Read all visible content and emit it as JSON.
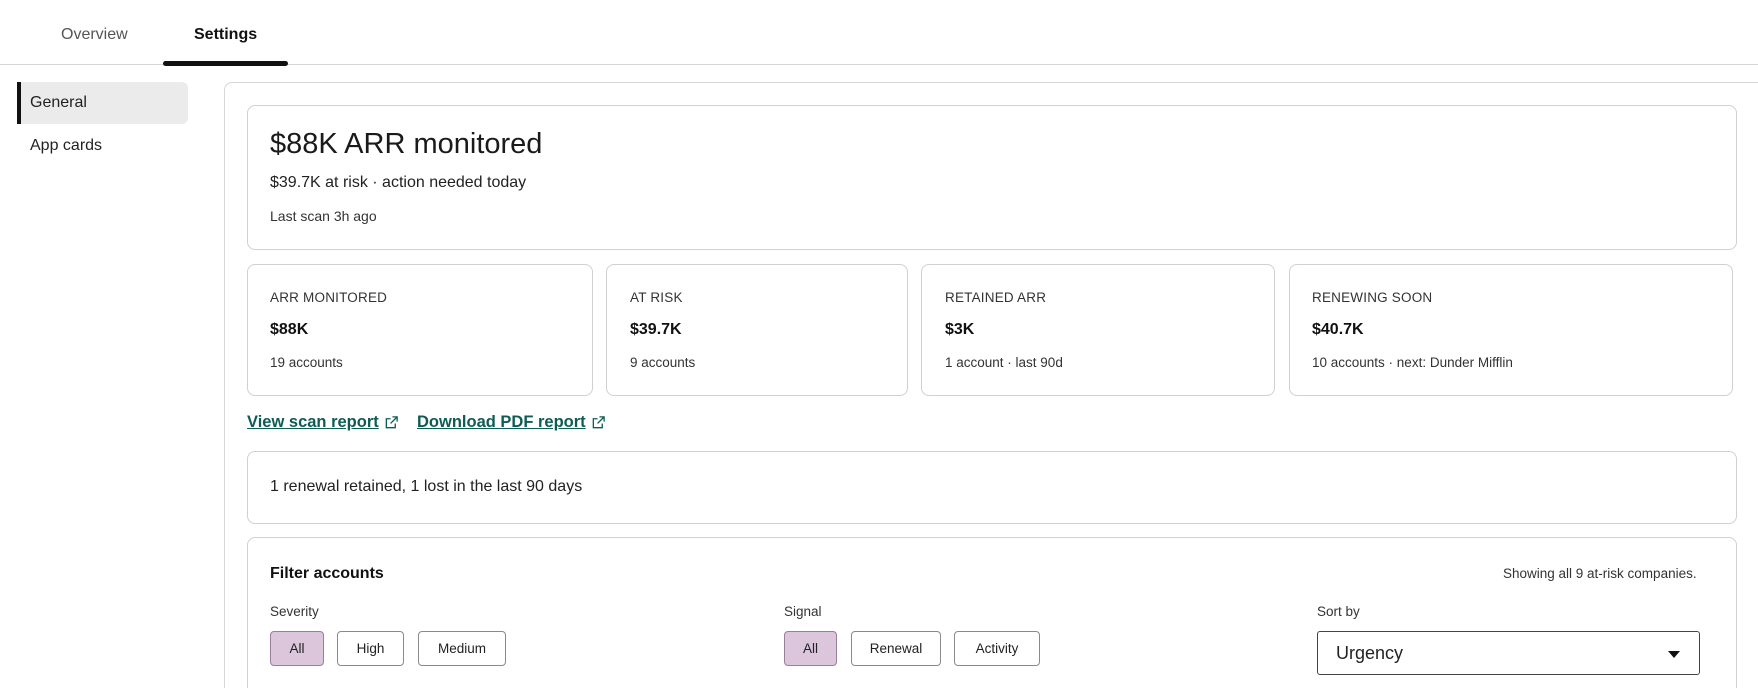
{
  "tabs": [
    {
      "label": "Overview",
      "active": false
    },
    {
      "label": "Settings",
      "active": true
    }
  ],
  "sidebar": {
    "items": [
      {
        "label": "General",
        "active": true
      },
      {
        "label": "App cards",
        "active": false
      }
    ]
  },
  "summary": {
    "title": "$88K ARR monitored",
    "subtitle": "$39.7K at risk · action needed today",
    "last_scan": "Last scan 3h ago"
  },
  "stats": [
    {
      "label": "ARR MONITORED",
      "value": "$88K",
      "sub": "19 accounts"
    },
    {
      "label": "AT RISK",
      "value": "$39.7K",
      "sub": "9 accounts"
    },
    {
      "label": "RETAINED ARR",
      "value": "$3K",
      "sub": "1 account · last 90d"
    },
    {
      "label": "RENEWING SOON",
      "value": "$40.7K",
      "sub": "10 accounts · next: Dunder Mifflin"
    }
  ],
  "links": {
    "view_scan": "View scan report",
    "download_pdf": "Download PDF report"
  },
  "retention_note": "1 renewal retained, 1 lost in the last 90 days",
  "filters": {
    "title": "Filter accounts",
    "count_text": "Showing all 9 at-risk companies.",
    "severity": {
      "label": "Severity",
      "options": [
        "All",
        "High",
        "Medium"
      ],
      "selected": "All"
    },
    "signal": {
      "label": "Signal",
      "options": [
        "All",
        "Renewal",
        "Activity"
      ],
      "selected": "All"
    },
    "sort": {
      "label": "Sort by",
      "value": "Urgency"
    }
  },
  "colors": {
    "link": "#0e5c55",
    "chip_selected": "#dcc6dc",
    "active_indicator": "#111111"
  },
  "icons": {
    "external_link": "external-link-icon",
    "dropdown": "chevron-down-icon"
  }
}
